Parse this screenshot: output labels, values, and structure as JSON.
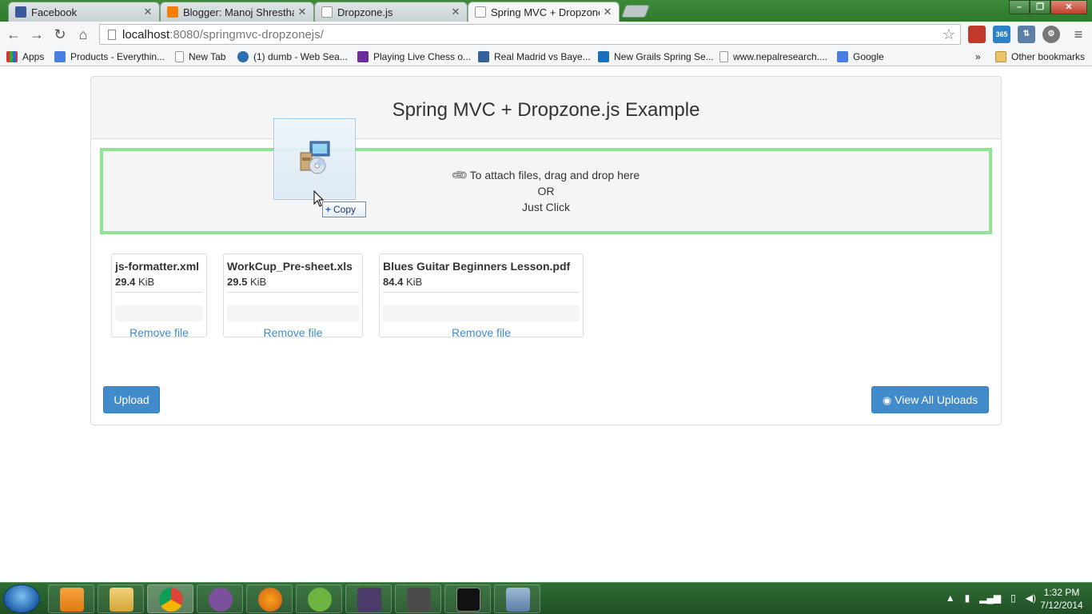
{
  "browser": {
    "tabs": [
      {
        "label": "Facebook",
        "icon": "facebook-icon",
        "color": "#3b5998"
      },
      {
        "label": "Blogger: Manoj Shrestha's",
        "icon": "blogger-icon",
        "color": "#f57d00"
      },
      {
        "label": "Dropzone.js",
        "icon": "page-icon",
        "color": "#ffffff"
      },
      {
        "label": "Spring MVC + Dropzone.js",
        "icon": "page-icon",
        "color": "#ffffff"
      }
    ],
    "url_host": "localhost",
    "url_path": ":8080/springmvc-dropzonejs/",
    "bookmarks": [
      {
        "label": "Apps",
        "icon": "apps-icon"
      },
      {
        "label": "Products - Everythin...",
        "icon": "google-icon"
      },
      {
        "label": "New Tab",
        "icon": "page-icon"
      },
      {
        "label": "(1) dumb - Web Sea...",
        "icon": "bing-icon"
      },
      {
        "label": "Playing Live Chess o...",
        "icon": "chess-icon"
      },
      {
        "label": "Real Madrid vs Baye...",
        "icon": "soccer-icon"
      },
      {
        "label": "New Grails Spring Se...",
        "icon": "grails-icon"
      },
      {
        "label": "www.nepalresearch....",
        "icon": "page-icon"
      },
      {
        "label": "Google",
        "icon": "google-icon"
      },
      {
        "label": "»",
        "icon": ""
      },
      {
        "label": "Other bookmarks",
        "icon": "folder-icon"
      }
    ]
  },
  "page": {
    "title": "Spring MVC + Dropzone.js Example",
    "dropzone": {
      "line1": "To attach files, drag and drop here",
      "line2": "OR",
      "line3": "Just Click"
    },
    "files": [
      {
        "name": "js-formatter.xml",
        "size": "29.4",
        "unit": "KiB",
        "remove": "Remove file"
      },
      {
        "name": "WorkCup_Pre-sheet.xls",
        "size": "29.5",
        "unit": "KiB",
        "remove": "Remove file"
      },
      {
        "name": "Blues Guitar Beginners Lesson.pdf",
        "size": "84.4",
        "unit": "KiB",
        "remove": "Remove file"
      }
    ],
    "upload_button": "Upload",
    "view_all_button": "View All Uploads"
  },
  "drag": {
    "tooltip": "Copy"
  },
  "taskbar": {
    "time": "1:32 PM",
    "date": "7/12/2014"
  }
}
